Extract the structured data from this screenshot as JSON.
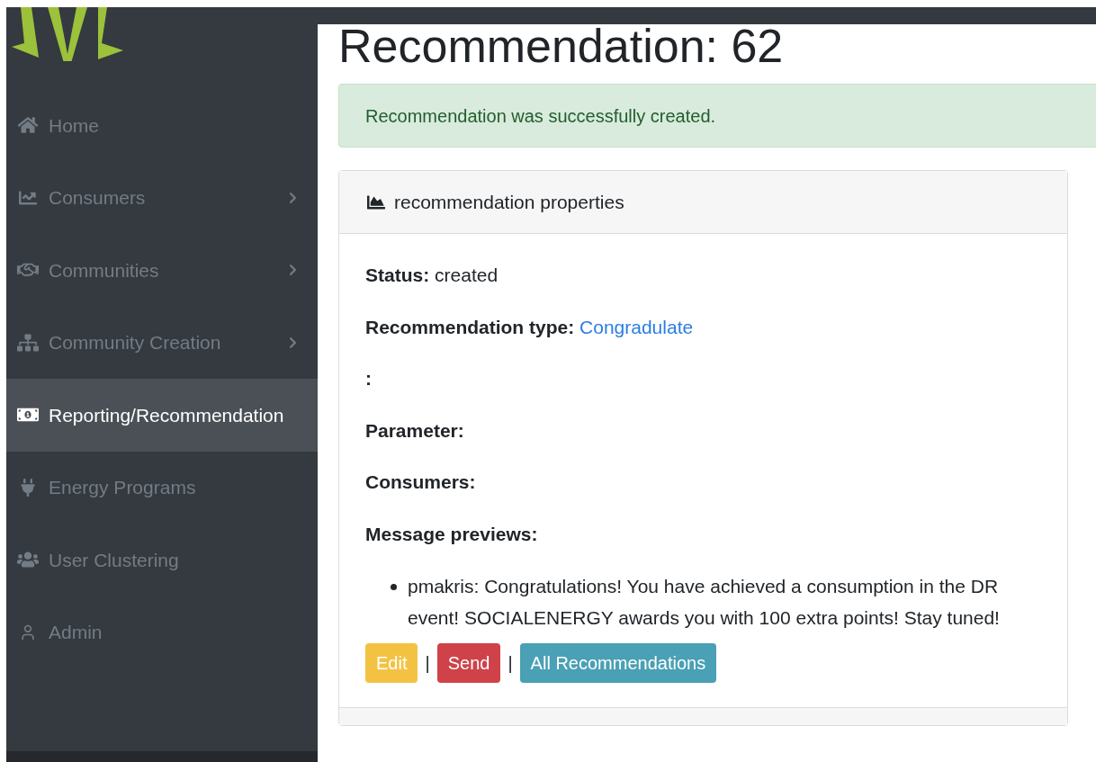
{
  "sidebar": {
    "items": [
      {
        "label": "Home",
        "selected": false,
        "has_submenu": false
      },
      {
        "label": "Consumers",
        "selected": false,
        "has_submenu": true
      },
      {
        "label": "Communities",
        "selected": false,
        "has_submenu": true
      },
      {
        "label": "Community Creation",
        "selected": false,
        "has_submenu": true
      },
      {
        "label": "Reporting/Recommendation",
        "selected": true,
        "has_submenu": false
      },
      {
        "label": "Energy Programs",
        "selected": false,
        "has_submenu": false
      },
      {
        "label": "User Clustering",
        "selected": false,
        "has_submenu": false
      },
      {
        "label": "Admin",
        "selected": false,
        "has_submenu": false
      }
    ]
  },
  "page": {
    "title": "Recommendation: 62",
    "alert": "Recommendation was successfully created.",
    "card": {
      "title": "recommendation properties",
      "fields": [
        {
          "label": "Status:",
          "value": "created",
          "kind": "text"
        },
        {
          "label": "Recommendation type:",
          "value": "Congradulate",
          "kind": "link"
        },
        {
          "label": ":",
          "kind": "text"
        },
        {
          "label": "Parameter:",
          "kind": "text"
        },
        {
          "label": "Consumers:",
          "kind": "text"
        },
        {
          "label": "Message previews:",
          "kind": "text"
        }
      ],
      "messages": [
        "pmakris: Congratulations! You have achieved a consumption in the DR event! SOCIALENERGY awards you with 100 extra points! Stay tuned!"
      ],
      "actions": [
        {
          "kind": "button",
          "label": "Edit",
          "color": "#f4c243"
        },
        {
          "kind": "separator",
          "label": "|"
        },
        {
          "kind": "button",
          "label": "Send",
          "color": "#cf4249"
        },
        {
          "kind": "separator",
          "label": "|"
        },
        {
          "kind": "button",
          "label": "All Recommendations",
          "color": "#4aa0b5"
        }
      ]
    }
  }
}
